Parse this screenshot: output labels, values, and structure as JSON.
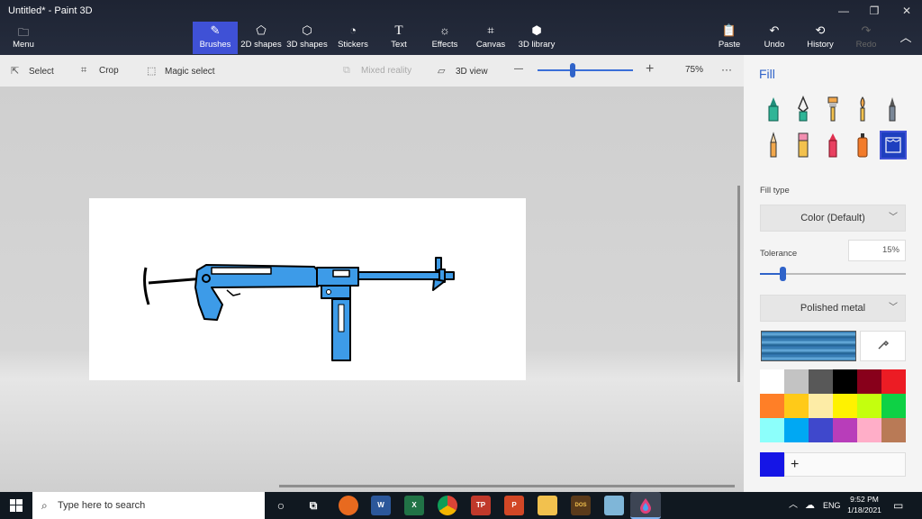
{
  "window": {
    "title": "Untitled* - Paint 3D",
    "minimize_icon": "minimize-icon",
    "maximize_icon": "maximize-icon",
    "close_icon": "close-icon"
  },
  "ribbon": {
    "menu": {
      "label": "Menu",
      "icon": "folder-icon"
    },
    "tools": [
      {
        "label": "Brushes",
        "icon": "brush-icon",
        "active": true
      },
      {
        "label": "2D shapes",
        "icon": "shapes-2d-icon"
      },
      {
        "label": "3D shapes",
        "icon": "cube-icon"
      },
      {
        "label": "Stickers",
        "icon": "sticker-icon"
      },
      {
        "label": "Text",
        "icon": "text-icon"
      },
      {
        "label": "Effects",
        "icon": "effects-icon"
      },
      {
        "label": "Canvas",
        "icon": "canvas-icon"
      },
      {
        "label": "3D library",
        "icon": "library-icon"
      }
    ],
    "actions": [
      {
        "label": "Paste",
        "icon": "paste-icon"
      },
      {
        "label": "Undo",
        "icon": "undo-icon"
      },
      {
        "label": "History",
        "icon": "history-icon"
      },
      {
        "label": "Redo",
        "icon": "redo-icon",
        "disabled": true
      }
    ]
  },
  "toolbar": {
    "select": "Select",
    "crop": "Crop",
    "magic_select": "Magic select",
    "mixed_reality": "Mixed reality",
    "view_3d": "3D view",
    "zoom_minus": "—",
    "zoom_plus": "+",
    "zoom_value": "75%",
    "zoom_level_percent": 75,
    "more": "···"
  },
  "panel": {
    "title": "Fill",
    "brushes": [
      "marker-icon",
      "calligraphy-pen-icon",
      "oil-brush-icon",
      "watercolor-icon",
      "pixel-pen-icon",
      "pencil-icon",
      "eraser-icon",
      "crayon-icon",
      "spray-can-icon",
      "fill-bucket-icon"
    ],
    "fill_type_label": "Fill type",
    "fill_type_value": "Color (Default)",
    "tolerance_label": "Tolerance",
    "tolerance_value": "15%",
    "tolerance_percent": 15,
    "material_value": "Polished metal",
    "eyedropper_icon": "eyedropper-icon",
    "swatches": [
      "#ffffff",
      "#c3c3c3",
      "#585858",
      "#000000",
      "#88001b",
      "#ec1c24",
      "#ff7f27",
      "#ffca18",
      "#fdeca6",
      "#fff200",
      "#c4ff0e",
      "#0ed145",
      "#8cfffb",
      "#00a8f3",
      "#3f48cc",
      "#b83dba",
      "#ffaec8",
      "#b97a56"
    ],
    "current_color": "#1515e6",
    "add_label": "+"
  },
  "taskbar": {
    "search_placeholder": "Type here to search",
    "apps": [
      {
        "name": "cortana-icon",
        "color": "#101820"
      },
      {
        "name": "task-view-icon",
        "color": "#101820"
      },
      {
        "name": "firefox-icon",
        "color": "#e86a1f"
      },
      {
        "name": "word-icon",
        "color": "#2b579a",
        "text": "W"
      },
      {
        "name": "excel-icon",
        "color": "#217346",
        "text": "X"
      },
      {
        "name": "chrome-icon",
        "color": "#db4437"
      },
      {
        "name": "tp-app-icon",
        "color": "#c0392b",
        "text": "TP"
      },
      {
        "name": "powerpoint-icon",
        "color": "#d24726",
        "text": "P"
      },
      {
        "name": "file-explorer-icon",
        "color": "#f2c14e"
      },
      {
        "name": "dosbox-icon",
        "color": "#5a3a1a",
        "text": "DOS"
      },
      {
        "name": "notes-icon",
        "color": "#7fb6d8"
      },
      {
        "name": "paint3d-icon",
        "color": "#e0407b",
        "active": true
      }
    ],
    "language": "ENG",
    "time": "9:52 PM",
    "date": "1/18/2021"
  }
}
